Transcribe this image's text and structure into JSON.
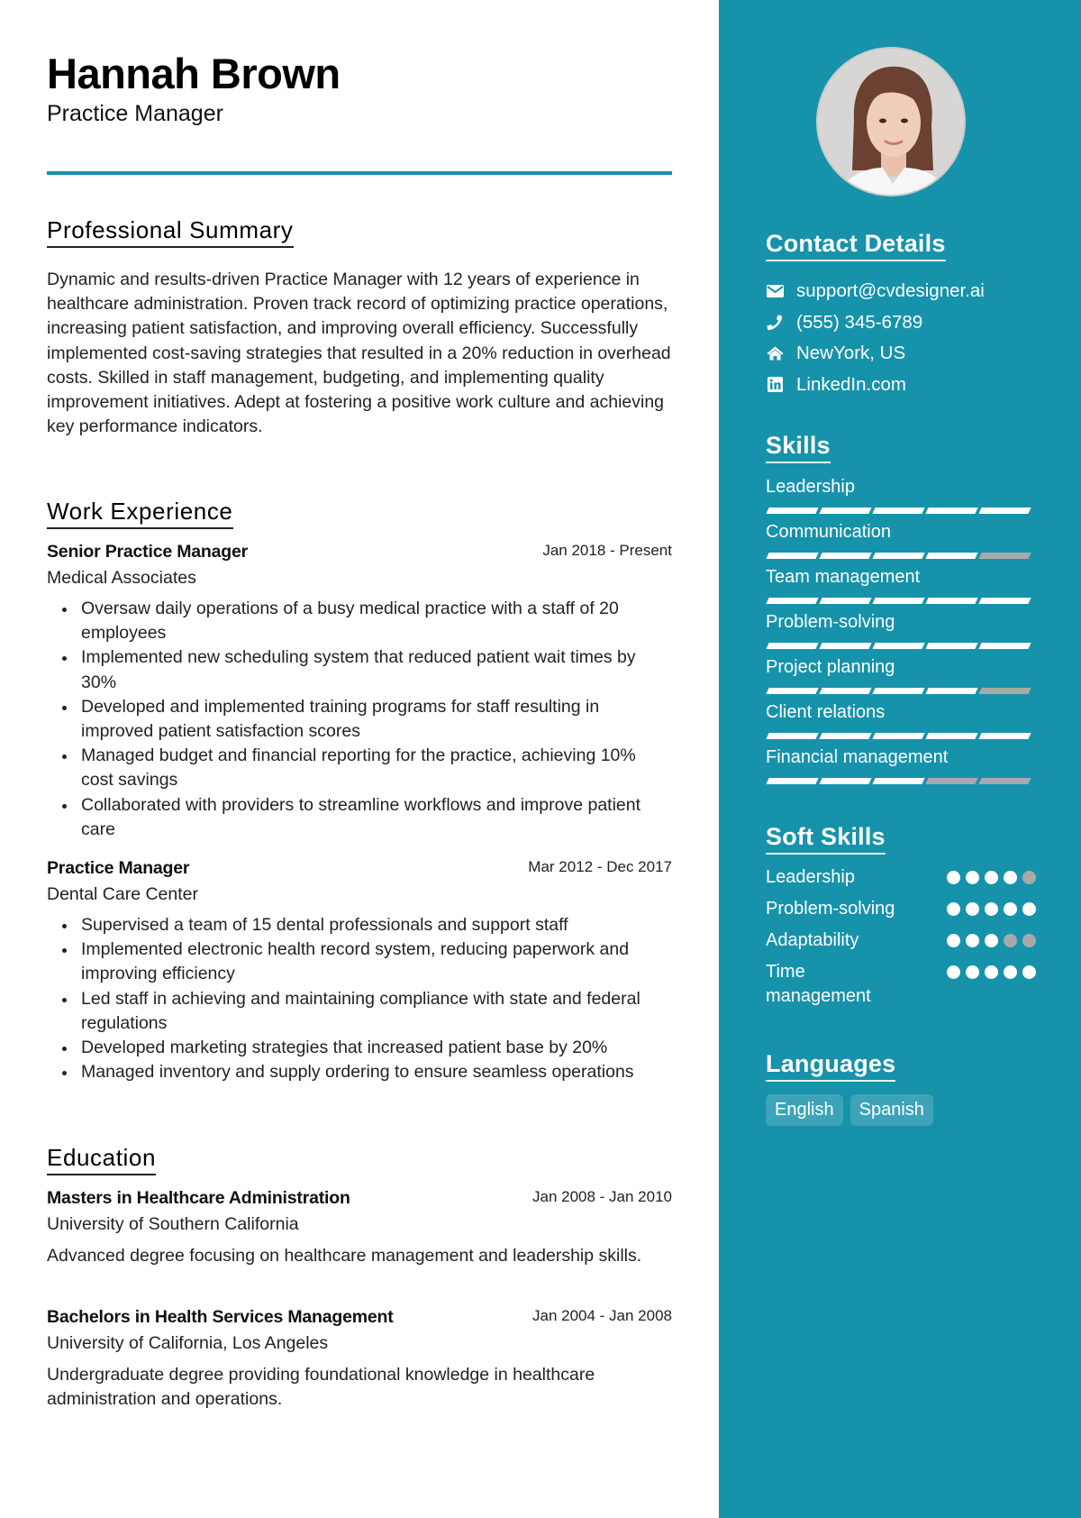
{
  "header": {
    "name": "Hannah Brown",
    "title": "Practice Manager"
  },
  "accent_color": "#1792ab",
  "summary": {
    "heading": "Professional Summary",
    "text": "Dynamic and results-driven Practice Manager with 12 years of experience in healthcare administration. Proven track record of optimizing practice operations, increasing patient satisfaction, and improving overall efficiency. Successfully implemented cost-saving strategies that resulted in a 20% reduction in overhead costs. Skilled in staff management, budgeting, and implementing quality improvement initiatives. Adept at fostering a positive work culture and achieving key performance indicators."
  },
  "experience": {
    "heading": "Work Experience",
    "jobs": [
      {
        "title": "Senior Practice Manager",
        "dates": "Jan 2018 - Present",
        "org": "Medical Associates",
        "bullets": [
          "Oversaw daily operations of a busy medical practice with a staff of 20 employees",
          "Implemented new scheduling system that reduced patient wait times by 30%",
          "Developed and implemented training programs for staff resulting in improved patient satisfaction scores",
          "Managed budget and financial reporting for the practice, achieving 10% cost savings",
          "Collaborated with providers to streamline workflows and improve patient care"
        ]
      },
      {
        "title": "Practice Manager",
        "dates": "Mar 2012 - Dec 2017",
        "org": "Dental Care Center",
        "bullets": [
          "Supervised a team of 15 dental professionals and support staff",
          "Implemented electronic health record system, reducing paperwork and improving efficiency",
          "Led staff in achieving and maintaining compliance with state and federal regulations",
          "Developed marketing strategies that increased patient base by 20%",
          "Managed inventory and supply ordering to ensure seamless operations"
        ]
      }
    ]
  },
  "education": {
    "heading": "Education",
    "items": [
      {
        "degree": "Masters in Healthcare Administration",
        "dates": "Jan 2008 - Jan 2010",
        "school": "University of Southern California",
        "description": "Advanced degree focusing on healthcare management and leadership skills."
      },
      {
        "degree": "Bachelors in Health Services Management",
        "dates": "Jan 2004 - Jan 2008",
        "school": "University of California, Los Angeles",
        "description": "Undergraduate degree providing foundational knowledge in healthcare administration and operations."
      }
    ]
  },
  "sidebar": {
    "contact": {
      "heading": "Contact Details",
      "items": [
        {
          "icon": "envelope-icon",
          "text": "support@cvdesigner.ai"
        },
        {
          "icon": "phone-icon",
          "text": "(555) 345-6789"
        },
        {
          "icon": "home-icon",
          "text": "NewYork, US"
        },
        {
          "icon": "linkedin-icon",
          "text": "LinkedIn.com"
        }
      ]
    },
    "skills": {
      "heading": "Skills",
      "max": 5,
      "items": [
        {
          "name": "Leadership",
          "level": 5
        },
        {
          "name": "Communication",
          "level": 4
        },
        {
          "name": "Team management",
          "level": 5
        },
        {
          "name": "Problem-solving",
          "level": 5
        },
        {
          "name": "Project planning",
          "level": 4
        },
        {
          "name": "Client relations",
          "level": 5
        },
        {
          "name": "Financial management",
          "level": 3
        }
      ]
    },
    "soft_skills": {
      "heading": "Soft Skills",
      "max": 5,
      "items": [
        {
          "name": "Leadership",
          "level": 4
        },
        {
          "name": "Problem-solving",
          "level": 5
        },
        {
          "name": "Adaptability",
          "level": 3
        },
        {
          "name": "Time management",
          "level": 5
        }
      ]
    },
    "languages": {
      "heading": "Languages",
      "items": [
        "English",
        "Spanish"
      ]
    }
  }
}
